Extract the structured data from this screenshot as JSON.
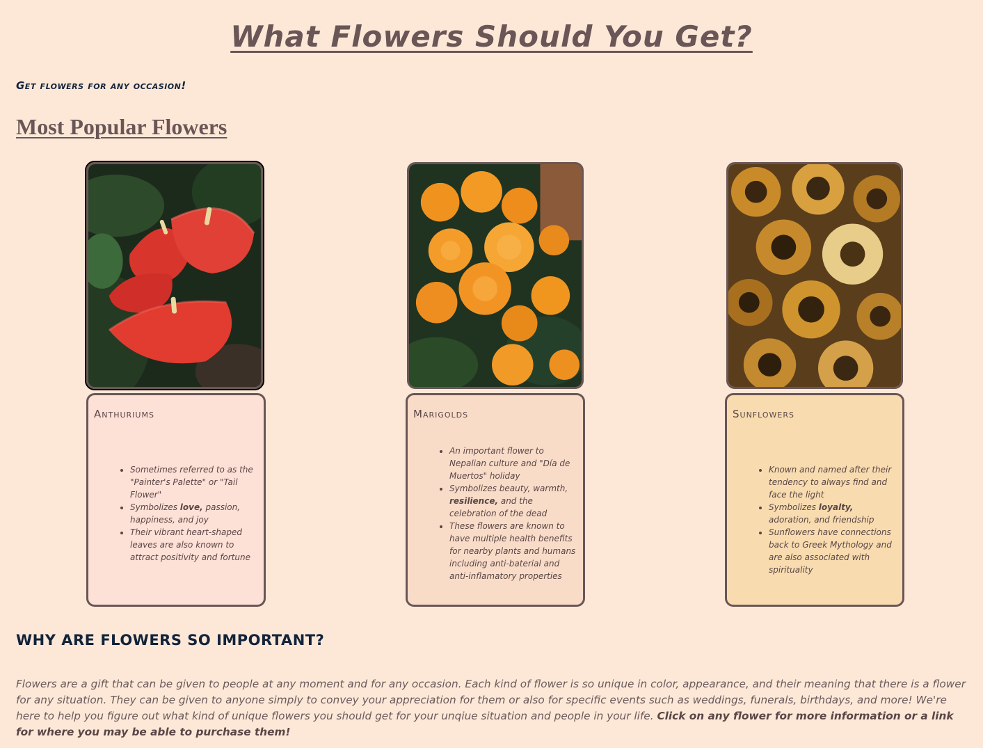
{
  "page": {
    "title": "What Flowers Should You Get?",
    "tagline": "Get flowers for any occasion!",
    "section_heading": "Most Popular Flowers"
  },
  "colors": {
    "background": "#fde8d8",
    "title_text": "#6a5656",
    "heading_dark": "#12233a",
    "card_border": "#6a5656",
    "anthurium_card": "#fde0d6",
    "marigold_card": "#f8dcc8",
    "sunflower_card": "#f8dcb0"
  },
  "flowers": [
    {
      "name": "Anthuriums",
      "photo_icon": "anthurium-photo",
      "bullets": [
        {
          "pre": "Sometimes referred to as the \"Painter's Palette\" or \"Tail Flower\"",
          "bold": "",
          "post": ""
        },
        {
          "pre": "Symbolizes ",
          "bold": "love,",
          "post": " passion, happiness, and joy"
        },
        {
          "pre": "Their vibrant heart-shaped leaves are also known to attract positivity and fortune",
          "bold": "",
          "post": ""
        }
      ]
    },
    {
      "name": "Marigolds",
      "photo_icon": "marigold-photo",
      "bullets": [
        {
          "pre": "An important flower to Nepalian culture and \"Día de Muertos\" holiday",
          "bold": "",
          "post": ""
        },
        {
          "pre": "Symbolizes beauty, warmth, ",
          "bold": "resilience,",
          "post": " and the celebration of the dead"
        },
        {
          "pre": "These flowers are known to have multiple health benefits for nearby plants and humans including anti-baterial and anti-inflamatory properties",
          "bold": "",
          "post": ""
        }
      ]
    },
    {
      "name": "Sunflowers",
      "photo_icon": "sunflower-photo",
      "bullets": [
        {
          "pre": "Known and named after their tendency to always find and face the light",
          "bold": "",
          "post": ""
        },
        {
          "pre": "Symbolizes ",
          "bold": "loyalty,",
          "post": " adoration, and friendship"
        },
        {
          "pre": "Sunflowers have connections back to Greek Mythology and are also associated with spirituality",
          "bold": "",
          "post": ""
        }
      ]
    }
  ],
  "why": {
    "heading": "WHY ARE FLOWERS SO IMPORTANT?",
    "body": "Flowers are a gift that can be given to people at any moment and for any occasion. Each kind of flower is so unique in color, appearance, and their meaning that there is a flower for any situation. They can be given to anyone simply to convey your appreciation for them or also for specific events such as weddings, funerals, birthdays, and more! We're here to help you figure out what kind of unique flowers you should get for your unqiue situation and people in your life. ",
    "call_to_action": "Click on any flower for more information or a link for where you may be able to purchase them!"
  }
}
